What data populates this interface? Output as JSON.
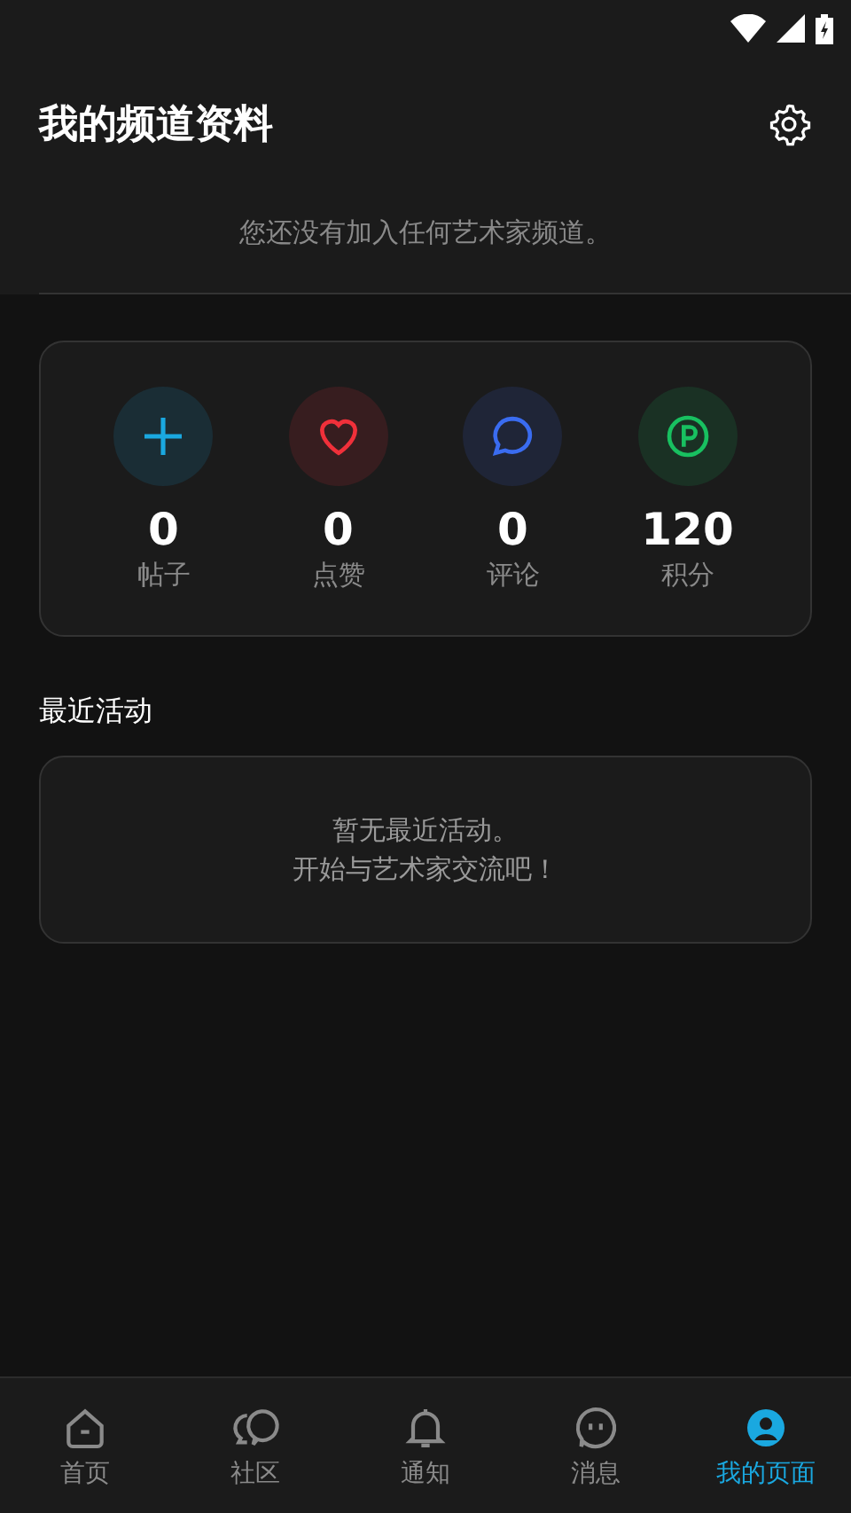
{
  "header": {
    "title": "我的频道资料",
    "notice": "您还没有加入任何艺术家频道。"
  },
  "stats": [
    {
      "kind": "plus",
      "color": "#1aa8e0",
      "value": "0",
      "label": "帖子"
    },
    {
      "kind": "heart",
      "color": "#f0303a",
      "value": "0",
      "label": "点赞"
    },
    {
      "kind": "chat",
      "color": "#3a6cf0",
      "value": "0",
      "label": "评论"
    },
    {
      "kind": "points",
      "color": "#18c060",
      "value": "120",
      "label": "积分"
    }
  ],
  "recent": {
    "title": "最近活动",
    "empty_lines": [
      "暂无最近活动。",
      "开始与艺术家交流吧！"
    ]
  },
  "nav": [
    {
      "kind": "home",
      "label": "首页",
      "selected": false
    },
    {
      "kind": "community",
      "label": "社区",
      "selected": false
    },
    {
      "kind": "bell",
      "label": "通知",
      "selected": false
    },
    {
      "kind": "message",
      "label": "消息",
      "selected": false
    },
    {
      "kind": "profile",
      "label": "我的页面",
      "selected": true
    }
  ]
}
